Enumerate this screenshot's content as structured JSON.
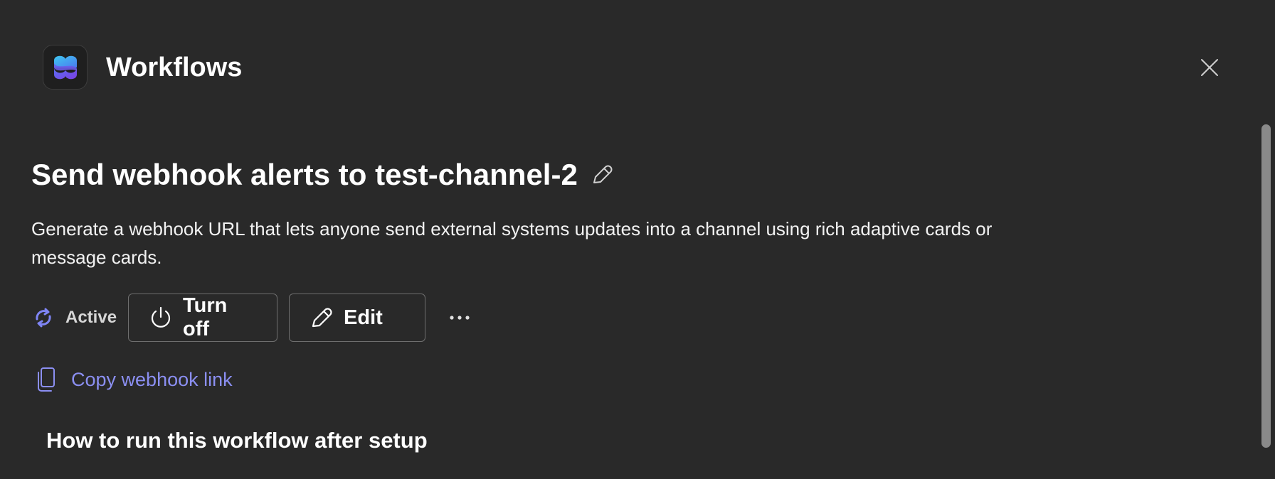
{
  "header": {
    "app_title": "Workflows",
    "logo_icon": "workflows-logo-icon",
    "close_icon": "close-icon"
  },
  "workflow": {
    "title": "Send webhook alerts to test-channel-2",
    "description": "Generate a webhook URL that lets anyone send external systems updates into a channel using rich adaptive cards or message cards.",
    "status_label": "Active",
    "status_icon": "sync-icon",
    "status_color": "#7f85f5"
  },
  "actions": {
    "turn_off_label": "Turn off",
    "edit_label": "Edit",
    "more_icon": "more-horizontal-icon"
  },
  "copy_link": {
    "label": "Copy webhook link",
    "color": "#8b8ff2"
  },
  "section": {
    "heading": "How to run this workflow after setup"
  },
  "theme": {
    "background": "#292929",
    "text": "#ffffff",
    "accent": "#7f85f5"
  }
}
